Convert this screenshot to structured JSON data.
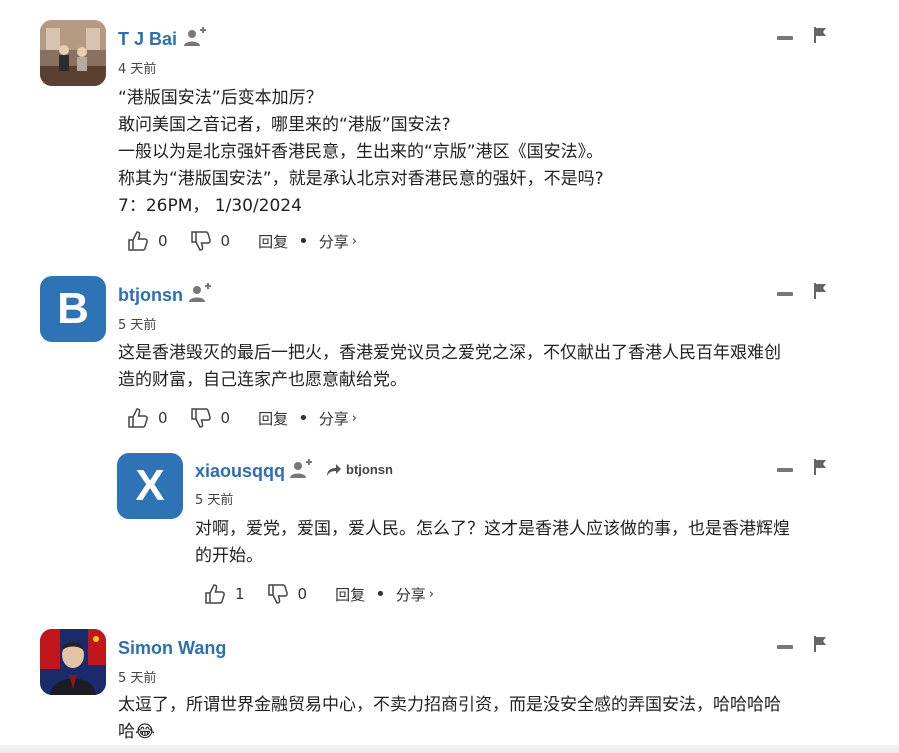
{
  "comments": [
    {
      "username": "T J Bai",
      "time": "4 天前",
      "lines": [
        "“港版国安法”后变本加厉？",
        "敢问美国之音记者，哪里来的“港版”国安法?",
        "一般以为是北京强奸香港民意，生出来的“京版”港区《国安法》。",
        "称其为“港版国安法”，就是承认北京对香港民意的强奸，不是吗?",
        "7：26PM， 1/30/2024"
      ],
      "likes": "0",
      "dislikes": "0",
      "reply_label": "回复",
      "share_label": "分享"
    },
    {
      "username": "btjonsn",
      "avatar_letter": "B",
      "time": "5 天前",
      "lines": [
        "这是香港毁灭的最后一把火，香港爱党议员之爱党之深，不仅献出了香港人民百年艰难创",
        "造的财富，自己连家产也愿意献给党。"
      ],
      "likes": "0",
      "dislikes": "0",
      "reply_label": "回复",
      "share_label": "分享"
    },
    {
      "username": "xiaousqqq",
      "avatar_letter": "X",
      "reply_to": "btjonsn",
      "time": "5 天前",
      "lines": [
        "对啊，爱党，爱国，爱人民。怎么了？这才是香港人应该做的事，也是香港辉煌",
        "的开始。"
      ],
      "likes": "1",
      "dislikes": "0",
      "reply_label": "回复",
      "share_label": "分享"
    },
    {
      "username": "Simon Wang",
      "time": "5 天前",
      "lines": [
        "太逗了，所谓世界金融贸易中心，不卖力招商引资，而是没安全感的弄国安法，哈哈哈哈",
        "哈😂"
      ]
    }
  ],
  "colors": {
    "username": "#2d6fb0",
    "avatar_letter_bg": "#2f73b7"
  }
}
